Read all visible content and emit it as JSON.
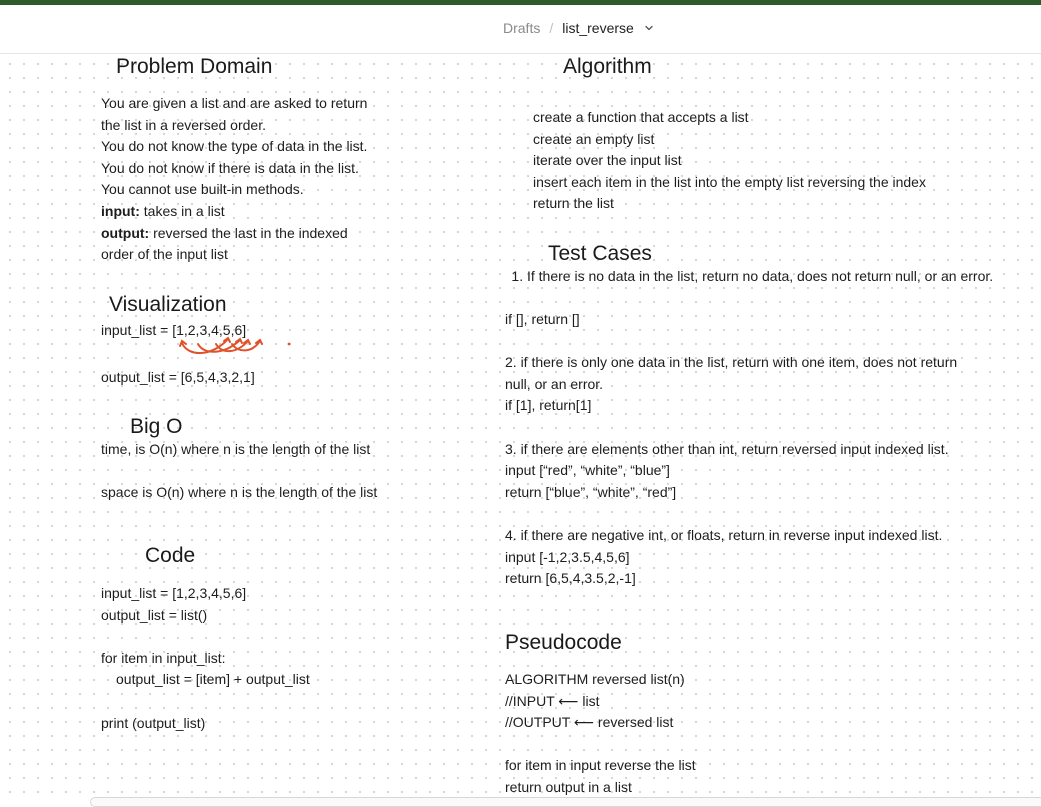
{
  "header": {
    "breadcrumb_parent": "Drafts",
    "breadcrumb_separator": "/",
    "breadcrumb_current": "list_reverse",
    "accent_color": "#2f5a2c"
  },
  "problem": {
    "heading": "Problem Domain",
    "lines": [
      "You are given a list and are asked to return",
      "the list in a reversed order.",
      "You do not know the type of data in the list.",
      "You do not know if there is data in the list.",
      "You cannot use built-in methods."
    ],
    "input_label": "input:",
    "input_text": " takes in a list",
    "output_label": "output:",
    "output_text": " reversed the last in the indexed",
    "output_text_2": "order of the input list"
  },
  "visualization": {
    "heading": "Visualization",
    "input_line": "input_list = [1,2,3,4,5,6]",
    "output_line": "output_list = [6,5,4,3,2,1]",
    "annotation_color": "#e0522b"
  },
  "bigo": {
    "heading": "Big O",
    "time": "time, is O(n) where n is the length of the list",
    "space": "space is O(n) where n is the length of the list"
  },
  "code": {
    "heading": "Code",
    "lines": [
      "input_list = [1,2,3,4,5,6]",
      "output_list = list()",
      "",
      "for item in input_list:",
      "output_list = [item] + output_list",
      "",
      "print (output_list)"
    ]
  },
  "algorithm": {
    "heading": "Algorithm",
    "steps": [
      "create a function that accepts a list",
      "create an empty list",
      "iterate over the input list",
      "insert each item in the list into the empty list reversing the index",
      "return the list"
    ]
  },
  "tests": {
    "heading": "Test Cases",
    "case1": "If there is no data in the list, return no data, does not return null, or an error.",
    "lines": [
      "if [], return []",
      "",
      "2. if there is only one data in the list, return with one item, does not return",
      "null, or an error.",
      "if [1], return[1]",
      "",
      "3. if there are elements other than int, return reversed input indexed list.",
      "input [“red”, “white”, “blue”]",
      "return [“blue”, “white”, “red”]",
      "",
      "4. if there are negative int, or floats, return in reverse input indexed list.",
      "input [-1,2,3.5,4,5,6]",
      "return [6,5,4,3.5,2,-1]"
    ]
  },
  "pseudocode": {
    "heading": "Pseudocode",
    "lines": [
      "ALGORITHM reversed list(n)",
      "//INPUT ⟵ list",
      "//OUTPUT ⟵ reversed  list",
      "",
      "for item in input reverse the list",
      "return output in a list"
    ]
  }
}
